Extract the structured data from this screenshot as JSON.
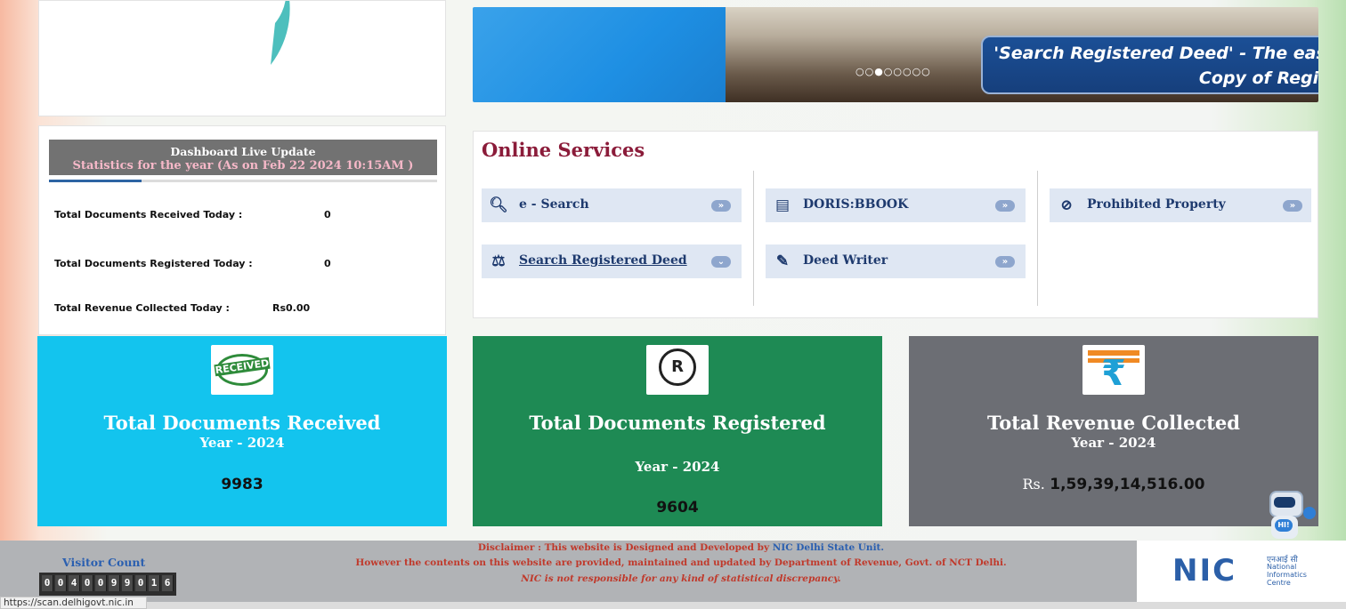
{
  "banner": {
    "caption_line1": "'Search Registered Deed' - The easy way to View  the Scan",
    "caption_line2": "Copy of Registered Documents",
    "dots": "○○●○○○○○"
  },
  "dashboard": {
    "title": "Dashboard Live Update",
    "subtitle": "Statistics for the year (As on Feb 22 2024 10:15AM )",
    "rows": [
      {
        "label": "Total Documents Received Today :",
        "value": "0"
      },
      {
        "label": "Total Documents Registered Today :",
        "value": "0"
      },
      {
        "label": "Total Revenue Collected Today :",
        "value": "Rs0.00"
      }
    ]
  },
  "online_services": {
    "title": "Online Services",
    "items": [
      {
        "label": "e - Search",
        "icon": "search-icon"
      },
      {
        "label": "DORIS:BBOOK",
        "icon": "book-icon"
      },
      {
        "label": "Prohibited Property",
        "icon": "check-circle-icon"
      },
      {
        "label": "Search Registered Deed",
        "icon": "gavel-icon"
      },
      {
        "label": "Deed Writer",
        "icon": "edit-icon"
      }
    ]
  },
  "stats": {
    "received": {
      "title": "Total Documents Received",
      "year": "Year - 2024",
      "value": "9983",
      "logo_text": "RECEIVED",
      "color": "#13c4ee"
    },
    "registered": {
      "title": "Total Documents Registered",
      "year": "Year - 2024",
      "value": "9604",
      "logo_text": "R",
      "color": "#1e8a54"
    },
    "revenue": {
      "title": "Total Revenue Collected",
      "year": "Year - 2024",
      "prefix": "Rs.",
      "value": "1,59,39,14,516.00",
      "logo_text": "₹",
      "color": "#6c6e74"
    }
  },
  "footer": {
    "disclaimer_prefix": "Disclaimer : This website is Designed and Developed by ",
    "disclaimer_org": "NIC Delhi State Unit.",
    "line2": "However the contents on this website are provided, maintained and updated by Department of Revenue, Govt. of NCT Delhi.",
    "line3": "NIC is not responsible for any kind of statistical discrepancy.",
    "visitor_label": "Visitor Count",
    "visitor_digits": [
      "0",
      "0",
      "4",
      "0",
      "0",
      "9",
      "9",
      "0",
      "1",
      "6"
    ],
    "nic_logo": "NIC",
    "nic_hindi": "एनआई सी",
    "nic_name_1": "National",
    "nic_name_2": "Informatics",
    "nic_name_3": "Centre",
    "chatbot_badge": "HI!"
  },
  "status_bar_url": "https://scan.delhigovt.nic.in"
}
